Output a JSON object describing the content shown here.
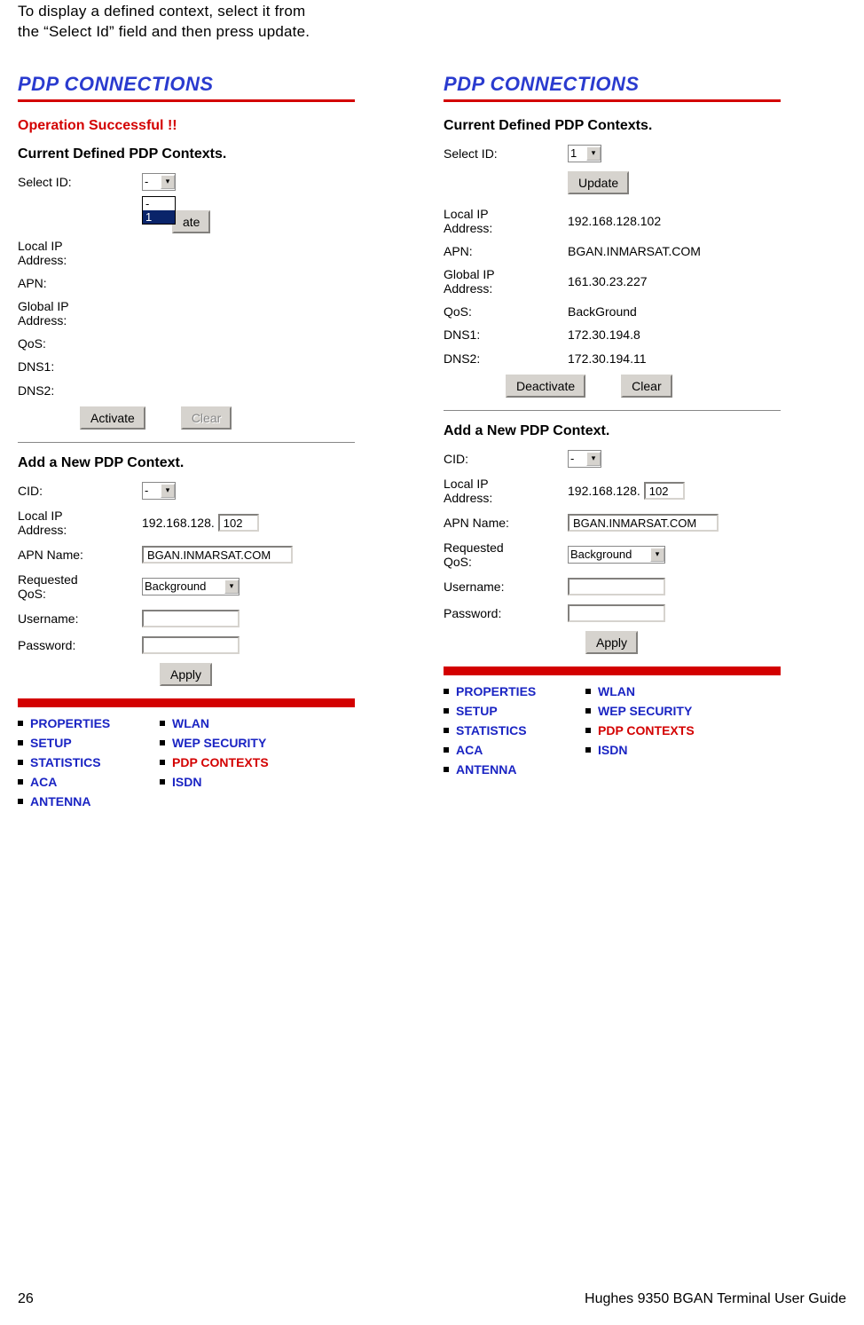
{
  "intro_line1": "To display a defined context, select it from",
  "intro_line2": "the “Select Id” field and then press update.",
  "left": {
    "title": "PDP CONNECTIONS",
    "success": "Operation Successful !!",
    "section1": "Current Defined PDP Contexts.",
    "select_label": "Select ID:",
    "select_value": "-",
    "list_opt0": "-",
    "list_opt1": "1",
    "update_btn_partial": "ate",
    "labels": {
      "localip": "Local IP\nAddress:",
      "apn": "APN:",
      "globalip": "Global IP\nAddress:",
      "qos": "QoS:",
      "dns1": "DNS1:",
      "dns2": "DNS2:"
    },
    "activate": "Activate",
    "clear": "Clear",
    "section2": "Add a New PDP Context.",
    "add": {
      "cid": "CID:",
      "cid_val": "-",
      "localip": "Local IP\nAddress:",
      "ip_prefix": "192.168.128.",
      "ip_last": "102",
      "apn": "APN Name:",
      "apn_val": "BGAN.INMARSAT.COM",
      "qos": "Requested\nQoS:",
      "qos_val": "Background",
      "user": "Username:",
      "pass": "Password:",
      "apply": "Apply"
    }
  },
  "right": {
    "title": "PDP CONNECTIONS",
    "section1": "Current Defined PDP Contexts.",
    "select_label": "Select ID:",
    "select_value": "1",
    "update": "Update",
    "labels": {
      "localip": "Local IP\nAddress:",
      "apn": "APN:",
      "globalip": "Global IP\nAddress:",
      "qos": "QoS:",
      "dns1": "DNS1:",
      "dns2": "DNS2:"
    },
    "values": {
      "localip": "192.168.128.102",
      "apn": "BGAN.INMARSAT.COM",
      "globalip": "161.30.23.227",
      "qos": "BackGround",
      "dns1": "172.30.194.8",
      "dns2": "172.30.194.11"
    },
    "deactivate": "Deactivate",
    "clear": "Clear",
    "section2": "Add a New PDP Context.",
    "add": {
      "cid": "CID:",
      "cid_val": "-",
      "localip": "Local IP\nAddress:",
      "ip_prefix": "192.168.128.",
      "ip_last": "102",
      "apn": "APN Name:",
      "apn_val": "BGAN.INMARSAT.COM",
      "qos": "Requested\nQoS:",
      "qos_val": "Background",
      "user": "Username:",
      "pass": "Password:",
      "apply": "Apply"
    }
  },
  "nav": {
    "properties": "PROPERTIES",
    "setup": "SETUP",
    "statistics": "STATISTICS",
    "aca": "ACA",
    "antenna": "ANTENNA",
    "wlan": "WLAN",
    "wep": "WEP SECURITY",
    "pdp": "PDP CONTEXTS",
    "isdn": "ISDN"
  },
  "footer": {
    "page": "26",
    "title": "Hughes 9350 BGAN Terminal User Guide"
  }
}
